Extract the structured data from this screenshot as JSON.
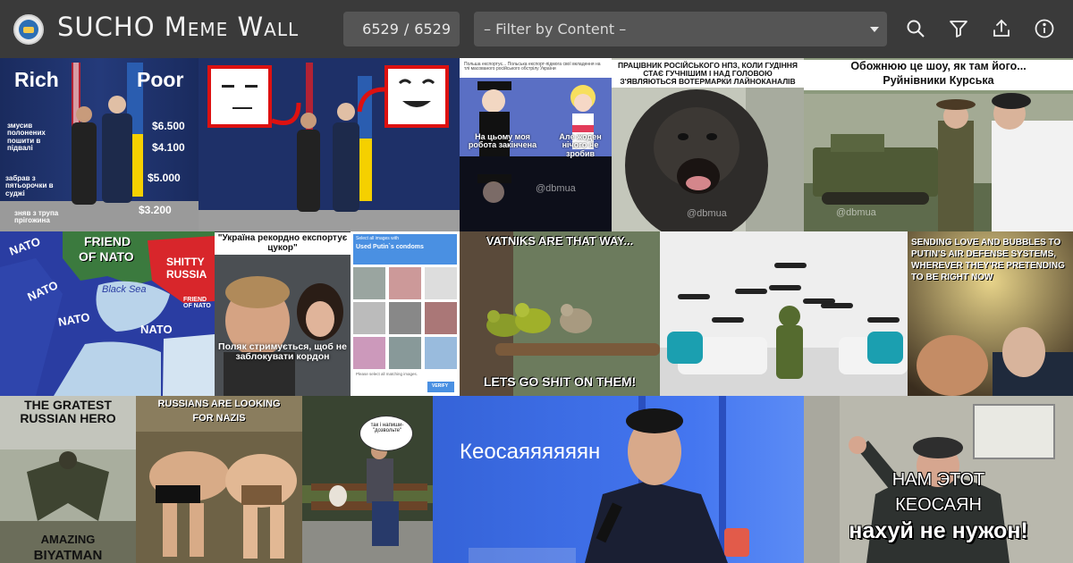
{
  "header": {
    "app_title": "SUCHO Meme Wall",
    "counter_current": "6529",
    "counter_separator": "/",
    "counter_total": "6529",
    "filter_placeholder": "– Filter by Content –",
    "icons": [
      "search-icon",
      "filter-icon",
      "upload-icon",
      "info-icon"
    ]
  },
  "colors": {
    "topbar": "#3a3a3a",
    "input_bg": "#555555",
    "text": "#f2f2f2"
  },
  "tiles": {
    "rich_poor": {
      "left": "Rich",
      "right": "Poor",
      "labels": [
        "змусив полонених пошити в підвалі",
        "забрав з пятьорочки в суджі",
        "зняв з трупа прігожина"
      ],
      "prices": [
        "$6.500",
        "$4.100",
        "$5.000",
        "$3.200"
      ]
    },
    "sailor": {
      "top_text": "Польша експортує... Польська експорт-підмога свої вкладення на тлі масованого російського обстрілу України",
      "left_caption": "На цьому моя робота закінчена",
      "right_caption": "Але жоден нічого не зробив"
    },
    "ape": {
      "caption": "ПРАЦІВНИК РОСІЙСЬКОГО НПЗ, КОЛИ ГУДІННЯ СТАЄ ГУЧНІШИМ І НАД ГОЛОВОЮ З'ЯВЛЯЮТЬСЯ ВОТЕРМАРКИ ЛАЙНОКАНАЛІВ"
    },
    "kursk": {
      "caption_line1": "Обожнюю це шоу, як там його...",
      "caption_line2": "Руйнівники Курська"
    },
    "nato_map": {
      "friend": "FRIEND",
      "of_nato": "OF NATO",
      "shitty": "SHITTY",
      "russia": "RUSSIA",
      "friend_small": "FRIEND OF NATO",
      "sea": "Black Sea",
      "nato": "NATO"
    },
    "ukraine_export": {
      "top": "\"Україна рекордно експортує цукор\"",
      "bottom": "Поляк стримується, щоб не заблокувати кордон"
    },
    "captcha": {
      "header_small": "Select all images with",
      "header_main": "Used Putin`s condoms",
      "footer": "Please select all matching images.",
      "verify": "VERIFY"
    },
    "vatniks": {
      "top": "VATNIKS ARE THAT WAY...",
      "bottom": "LETS GO SHIT ON THEM!"
    },
    "love_bubbles": {
      "caption": "SENDING LOVE AND BUBBLES TO PUTIN'S AIR DEFENSE SYSTEMS, WHEREVER THEY'RE PRETENDING TO BE RIGHT NOW"
    },
    "batman": {
      "top": "THE GRATEST RUSSIAN HERO",
      "bottom_1": "AMAZING",
      "bottom_2": "BIYATMAN"
    },
    "nazis": {
      "caption_1": "RUSSIANS ARE LOOKING",
      "caption_2": "FOR NAZIS"
    },
    "bench": {
      "bubble": "так і напиши-\"дозвольте\""
    },
    "keosayan_singer": {
      "caption": "Кеосаяяяяяян"
    },
    "keosayan_woman": {
      "line1": "НАМ ЭТОТ",
      "line2": "КЕОСАЯН",
      "line3": "нахуй не нужон!"
    },
    "watermark": "@dbmua"
  }
}
